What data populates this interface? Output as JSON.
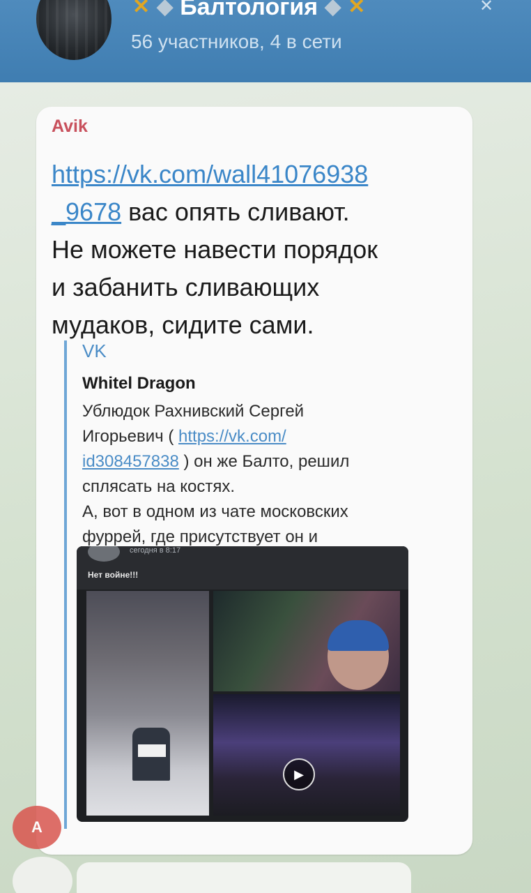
{
  "header": {
    "title": "Балтология",
    "subtitle": "56 участников, 4 в сети",
    "left_emojis": [
      "ribbon-emoji",
      "wolf-emoji"
    ],
    "right_emojis": [
      "wolf-emoji",
      "ribbon-emoji"
    ],
    "accent_color": "#3f7db1"
  },
  "message": {
    "sender": "Avik",
    "link_part1": "https://vk.com/wall41076938",
    "link_part2": "_9678",
    "text_line1_tail": " вас опять сливают.",
    "text_line2": "Не можете навести порядок",
    "text_line3": "и забанить сливающих",
    "text_line4": "мудаков, сидите сами.",
    "sender_color": "#c8505c"
  },
  "preview": {
    "site": "VK",
    "title": "Whitel Dragon",
    "desc_line1": "Ублюдок Рахнивский Сергей",
    "desc_line2_head": "Игорьевич ( ",
    "desc_link1": "https://vk.com/",
    "desc_link2": "id308457838",
    "desc_line3_tail": " ) он же Балто, решил",
    "desc_line4": "сплясать на костях.",
    "desc_line5": "А, вот в одном из чате московских",
    "desc_line6": "фуррей, где присутствует он и",
    "media_time": "сегодня в 8:17",
    "media_caption": "Нет войне!!!"
  },
  "scroll_button": {
    "label": "A"
  }
}
